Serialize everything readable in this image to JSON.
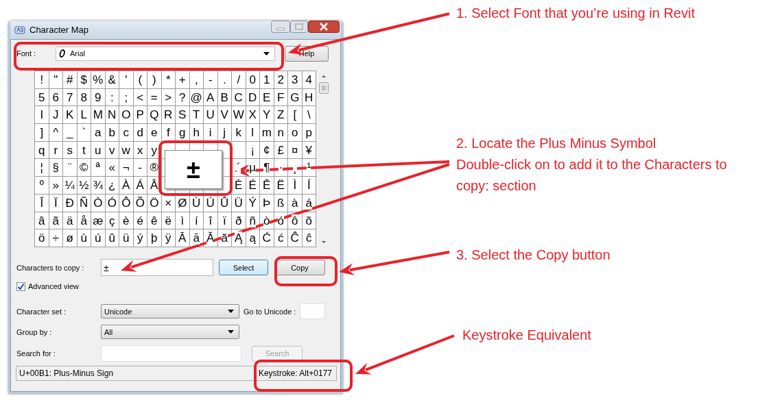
{
  "window": {
    "title": "Character Map"
  },
  "font": {
    "label": "Font :",
    "value": "Arial"
  },
  "help_button": "Help",
  "grid": {
    "rows": [
      [
        "!",
        "\"",
        "#",
        "$",
        "%",
        "&",
        "'",
        "(",
        ")",
        "*",
        "+",
        ",",
        "-",
        ".",
        "/",
        "0",
        "1",
        "2",
        "3",
        "4"
      ],
      [
        "5",
        "6",
        "7",
        "8",
        "9",
        ":",
        ";",
        "<",
        "=",
        ">",
        "?",
        "@",
        "A",
        "B",
        "C",
        "D",
        "E",
        "F",
        "G",
        "H"
      ],
      [
        "I",
        "J",
        "K",
        "L",
        "M",
        "N",
        "O",
        "P",
        "Q",
        "R",
        "S",
        "T",
        "U",
        "V",
        "W",
        "X",
        "Y",
        "Z",
        "[",
        "\\"
      ],
      [
        "]",
        "^",
        "_",
        "`",
        "a",
        "b",
        "c",
        "d",
        "e",
        "f",
        "g",
        "h",
        "i",
        "j",
        "k",
        "l",
        "m",
        "n",
        "o",
        "p"
      ],
      [
        "q",
        "r",
        "s",
        "t",
        "u",
        "v",
        "w",
        "x",
        "y",
        null,
        null,
        null,
        null,
        null,
        null,
        "¡",
        "¢",
        "£",
        "¤",
        "¥"
      ],
      [
        "¦",
        "§",
        "¨",
        "©",
        "ª",
        "«",
        "¬",
        "-",
        "®",
        null,
        null,
        null,
        null,
        null,
        "´",
        "µ",
        "¶",
        "·",
        "¸",
        "¹"
      ],
      [
        "º",
        "»",
        "¼",
        "½",
        "¾",
        "¿",
        "À",
        "Á",
        "Â",
        null,
        null,
        null,
        null,
        null,
        "È",
        "É",
        "Ê",
        "Ë",
        "Ì",
        "Í"
      ],
      [
        "Î",
        "Ï",
        "Ð",
        "Ñ",
        "Ò",
        "Ó",
        "Ô",
        "Õ",
        "Ö",
        "×",
        "Ø",
        "Ù",
        "Ú",
        "Û",
        "Ü",
        "Ý",
        "Þ",
        "ß",
        "à",
        "á"
      ],
      [
        "â",
        "ã",
        "ä",
        "å",
        "æ",
        "ç",
        "è",
        "é",
        "ê",
        "ë",
        "ì",
        "í",
        "î",
        "ï",
        "ð",
        "ñ",
        "ò",
        "ó",
        "ô",
        "õ"
      ],
      [
        "ö",
        "÷",
        "ø",
        "ù",
        "ú",
        "û",
        "ü",
        "ý",
        "þ",
        "ÿ",
        "Ā",
        "ā",
        "Ă",
        "ă",
        "Ą",
        "ą",
        "Ć",
        "ć",
        "Ĉ",
        "ĉ"
      ]
    ]
  },
  "popup": {
    "char": "±"
  },
  "copy_field": {
    "label": "Characters to copy :",
    "value": "±"
  },
  "select_button": "Select",
  "copy_button": "Copy",
  "advanced_view": {
    "label": "Advanced view",
    "checked": true
  },
  "character_set": {
    "label": "Character set :",
    "value": "Unicode"
  },
  "go_to_unicode": {
    "label": "Go to Unicode :"
  },
  "group_by": {
    "label": "Group by :",
    "value": "All"
  },
  "search_for": {
    "label": "Search for :"
  },
  "search_button": {
    "label": "Search",
    "disabled": true
  },
  "status_bar": {
    "description": "U+00B1: Plus-Minus Sign",
    "keystroke": "Keystroke: Alt+0177"
  },
  "annotations": [
    {
      "lines": [
        "1.  Select Font that you’re using in Revit"
      ]
    },
    {
      "lines": [
        "2.  Locate the Plus Minus Symbol",
        "Double-click on to add it to the Characters to",
        "copy: section"
      ]
    },
    {
      "lines": [
        "3.  Select the Copy button"
      ]
    },
    {
      "lines": [
        "Keystroke Equivalent"
      ]
    }
  ]
}
